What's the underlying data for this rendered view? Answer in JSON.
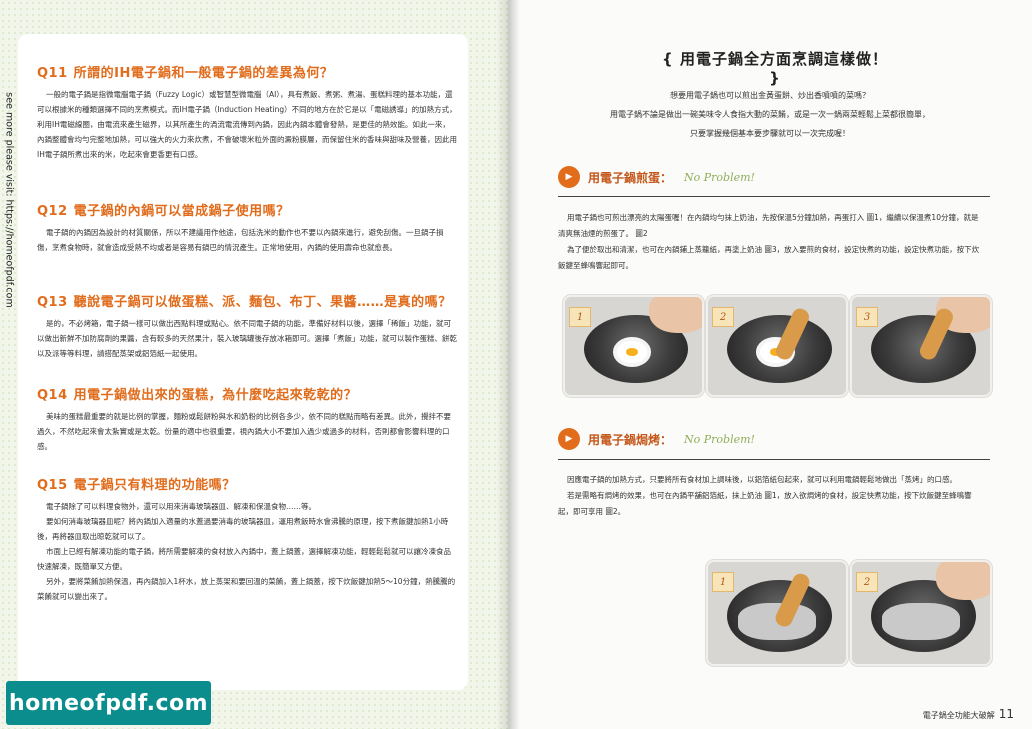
{
  "side_url": "see more please visit: https://homeofpdf.com",
  "watermark": "homeofpdf.com",
  "left": {
    "qa": [
      {
        "num": "Q11",
        "title": "所謂的IH電子鍋和一般電子鍋的差異為何？",
        "paras": [
          "一般的電子鍋是指微電腦電子鍋（Fuzzy Logic）或智慧型微電腦（AI），具有煮飯、煮粥、煮湯、蛋糕料理的基本功能，還可以根據米的種類選擇不同的烹煮模式。而IH電子鍋（Induction Heating）不同的地方在於它是以「電磁誘導」的加熱方式，利用IH電磁線圈，由電流來產生磁界，以其所產生的渦流電流傳到內鍋，因此內鍋本體會發熱，是更佳的熱效能。如此一來，內鍋整體會均勻完整地加熱，可以強大的火力來炊煮，不會破壞米粒外面的澱粉膜層，而保留住米的香味與甜味及營養，因此用IH電子鍋所煮出來的米，吃起來會更香更有口感。"
        ]
      },
      {
        "num": "Q12",
        "title": "電子鍋的內鍋可以當成鍋子使用嗎？",
        "paras": [
          "電子鍋的內鍋因為設計的材質關係，所以不建議用作他途，包括洗米的動作也不要以內鍋來進行，避免刮傷。一旦鍋子損傷，烹煮食物時，就會造成受熱不均或者是容易有鍋巴的情況產生。正常地使用，內鍋的使用壽命也就愈長。"
        ]
      },
      {
        "num": "Q13",
        "title": "聽說電子鍋可以做蛋糕、派、麵包、布丁、果醬……是真的嗎？",
        "paras": [
          "是的，不必烤箱，電子鍋一樣可以做出西點料理或點心。依不同電子鍋的功能，準備好材料以後，選擇「稀飯」功能，就可以做出新鮮不加防腐劑的果醬，含有較多的天然果汁，裝入玻璃罐後存放冰箱即可。選擇「煮飯」功能，就可以製作蛋糕、餅乾以及派等等料理，請搭配蒸架或鋁箔紙一起使用。"
        ]
      },
      {
        "num": "Q14",
        "title": "用電子鍋做出來的蛋糕，為什麼吃起來乾乾的？",
        "paras": [
          "美味的蛋糕最重要的就是比例的掌握，麵粉或鬆餅粉與水和奶粉的比例各多少，依不同的糕點而略有差異。此外，攪拌不要過久，不然吃起來會太紮實或是太乾。份量的適中也很重要，視內鍋大小不要加入過少或過多的材料，否則都會影響料理的口感。"
        ]
      },
      {
        "num": "Q15",
        "title": "電子鍋只有料理的功能嗎？",
        "paras": [
          "電子鍋除了可以料理食物外，還可以用來消毒玻璃器皿、解凍和保溫食物……等。",
          "要如何消毒玻璃器皿呢？將內鍋加入適量的水蓋過要消毒的玻璃器皿，運用煮飯時水會沸騰的原理，按下煮飯鍵加熱1小時後，再將器皿取出晾乾就可以了。",
          "市面上已經有解凍功能的電子鍋，將所需要解凍的食材放入內鍋中，蓋上鍋蓋，選擇解凍功能，輕輕鬆鬆就可以讓冷凍食品快速解凍，既簡單又方便。",
          "另外，要將菜餚加熱保溫，再內鍋加入1杯水，放上蒸架和要回溫的菜餚，蓋上鍋蓋，按下炊飯鍵加熱5～10分鐘，熱騰騰的菜餚就可以變出來了。"
        ]
      }
    ]
  },
  "right": {
    "title": "{ 用電子鍋全方面烹調這樣做！ }",
    "intro": [
      "想要用電子鍋也可以煎出金黃蛋餅、炒出香噴噴的菜嗎？",
      "用電子鍋不論是做出一碗美味令人食指大動的菜餚，或是一次一鍋兩菜輕鬆上菜都很簡單，",
      "只要掌握幾個基本要步驟就可以一次完成喔！"
    ],
    "sections": [
      {
        "icon": "▶",
        "title": "用電子鍋煎蛋：",
        "tag": "No Problem!",
        "paras": [
          "用電子鍋也可煎出漂亮的太陽蛋喔！在內鍋均勻抹上奶油，先按保溫5分鐘加熱，再蛋打入 圖1，繼續以保溫煮10分鐘，就是清爽無油煙的煎蛋了。 圖2",
          "為了便於取出和清潔，也可在內鍋鋪上蒸籠紙，再塗上奶油 圖3，放入要煎的食材，設定快煮的功能，設定快煮功能，按下炊飯鍵至蜂鳴響起即可。"
        ],
        "steps": [
          "1",
          "2",
          "3"
        ]
      },
      {
        "icon": "▶",
        "title": "用電子鍋焗烤：",
        "tag": "No Problem!",
        "paras": [
          "因應電子鍋的加熱方式，只要將所有食材加上調味後，以鋁箔紙包起來，就可以利用電鍋輕鬆地做出「蒸烤」的口感。",
          "若是需略有焗烤的效果，也可在內鍋平舖鋁箔紙，抹上奶油 圖1，放入欲焗烤的食材，設定快煮功能，按下炊飯鍵至蜂鳴響起，即可享用 圖2。"
        ],
        "steps": [
          "1",
          "2"
        ]
      }
    ],
    "footer": {
      "label": "電子鍋全功能大破解",
      "page": "11"
    }
  }
}
